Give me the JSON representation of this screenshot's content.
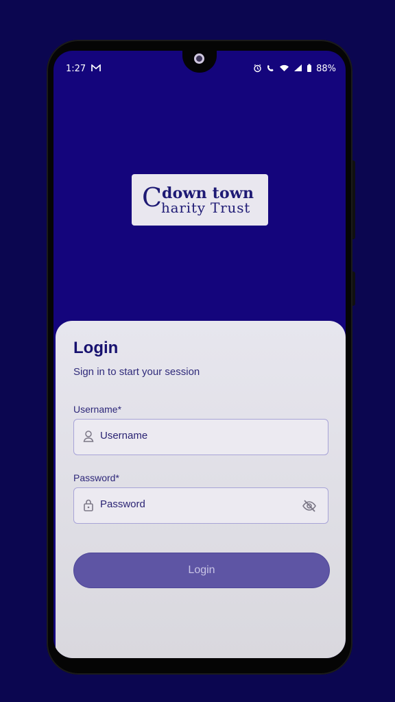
{
  "status_bar": {
    "time": "1:27",
    "mail_icon": "gmail-icon",
    "battery": "88%"
  },
  "logo": {
    "line_top": "down town",
    "line_bottom": "harity Trust",
    "initial": "C"
  },
  "login": {
    "title": "Login",
    "subtitle": "Sign in to start your session",
    "username_label": "Username*",
    "username_placeholder": "Username",
    "password_label": "Password*",
    "password_placeholder": "Password",
    "button_label": "Login"
  },
  "colors": {
    "background": "#0b0650",
    "screen": "#14057c",
    "card": "#e7e6ee",
    "button": "#5e55a4",
    "text_primary": "#17116f"
  }
}
